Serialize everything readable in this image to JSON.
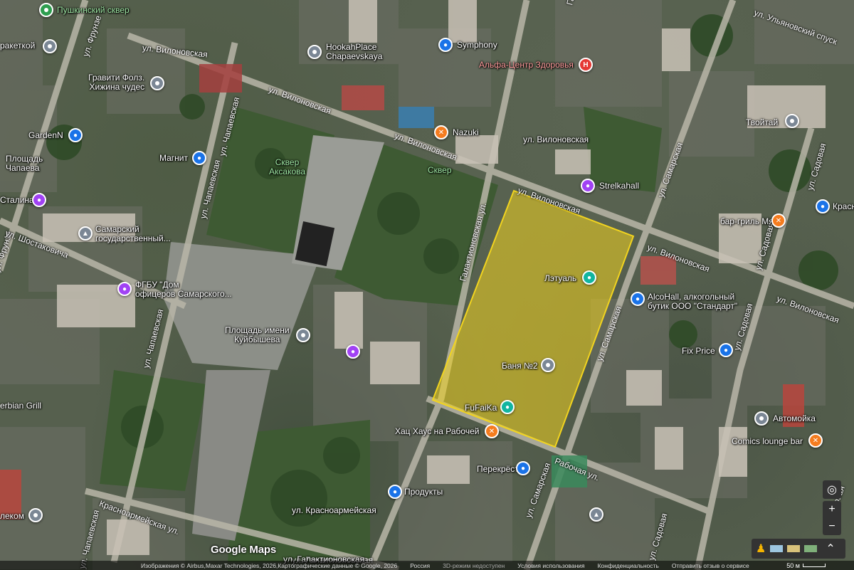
{
  "map": {
    "attribution": "Изображения © Airbus,Maxar Technologies, 2026,Картографические данные © Google, 2026",
    "footer_links": [
      "Россия",
      "3D-режим недоступен",
      "Условия использования",
      "Конфиденциальность",
      "Отправить отзыв о сервисе"
    ],
    "scale_label": "50 м",
    "logo": "Google Maps",
    "highlight_color": "#f2d41f"
  },
  "streets": [
    "ул. Вилоновская",
    "ул. Вилоновская",
    "ул. Вилоновская",
    "ул. Вилоновская",
    "ул. Вилоновская",
    "ул. Вилоновская",
    "ул. Фрунзе",
    "ул. Фрунзе",
    "ул. Чапаевская",
    "ул. Чапаевская",
    "ул. Чапаевская",
    "ул. Чапаевская",
    "ул. Шостаковича",
    "Галактионовская ул.",
    "Галактионовская ул.",
    "ул. Самарская",
    "ул. Самарская",
    "ул. Самарская",
    "ул. Садовая",
    "ул. Садовая",
    "ул. Садовая",
    "ул. Садовая",
    "Рабочая ул.",
    "Красноармейская ул.",
    "ул. Галактионовская",
    "ул. Ульяновский спуск",
    "ул. Садовая"
  ],
  "places": [
    {
      "name": "Пушкинский сквер",
      "kind": "green"
    },
    {
      "name": "ракеткой",
      "kind": "gray"
    },
    {
      "name": "HookahPlace\nChapaevskaya",
      "kind": "gray"
    },
    {
      "name": "Symphony",
      "kind": "blue"
    },
    {
      "name": "Альфа-Центр Здоровья",
      "kind": "red"
    },
    {
      "name": "Гравити Фолз.\nХижина чудес",
      "kind": "gray"
    },
    {
      "name": "GardenN",
      "kind": "blue"
    },
    {
      "name": "Nazuki",
      "kind": "orange"
    },
    {
      "name": "ул. Вилоновская",
      "kind": "transit"
    },
    {
      "name": "Магнит",
      "kind": "blue"
    },
    {
      "name": "Площадь\nЧапаева",
      "kind": "text"
    },
    {
      "name": "Сквер\nАксакова",
      "kind": "greentext"
    },
    {
      "name": "Сквер",
      "kind": "greentext"
    },
    {
      "name": "Strelkahall",
      "kind": "purple"
    },
    {
      "name": "Твойтай",
      "kind": "gray"
    },
    {
      "name": "Краснодар",
      "kind": "blue"
    },
    {
      "name": "бар-гриль МясО",
      "kind": "orange"
    },
    {
      "name": "Сталина",
      "kind": "purple"
    },
    {
      "name": "Самарский\nгосударственный...",
      "kind": "gray"
    },
    {
      "name": "Лэтуаль",
      "kind": "teal"
    },
    {
      "name": "ФГБУ \"Дом\nофицеров Самарского...",
      "kind": "purple"
    },
    {
      "name": "AlcoHall, алкогольный\nбутик ООО \"Стандарт\"",
      "kind": "blue"
    },
    {
      "name": "Площадь имени\nКуйбышева",
      "kind": "gray"
    },
    {
      "name": "Баня №2",
      "kind": "gray"
    },
    {
      "name": "Fix Price",
      "kind": "blue"
    },
    {
      "name": "FuFaiKa",
      "kind": "teal"
    },
    {
      "name": "Хац Хаус на Рабочей",
      "kind": "orange"
    },
    {
      "name": "Автомойка",
      "kind": "gray"
    },
    {
      "name": "Comics lounge bar",
      "kind": "orange"
    },
    {
      "name": "Перекрёсток",
      "kind": "blue"
    },
    {
      "name": "Продукты",
      "kind": "blue"
    },
    {
      "name": "ул. Красноармейская",
      "kind": "transit"
    },
    {
      "name": "erbian Grill",
      "kind": "text"
    },
    {
      "name": "лeком",
      "kind": "gray"
    },
    {
      "name": "ул. Галактионовская",
      "kind": "transit"
    }
  ],
  "controls": {
    "locate": "◎",
    "zoom_in": "+",
    "zoom_out": "−",
    "expand": "⌃"
  }
}
